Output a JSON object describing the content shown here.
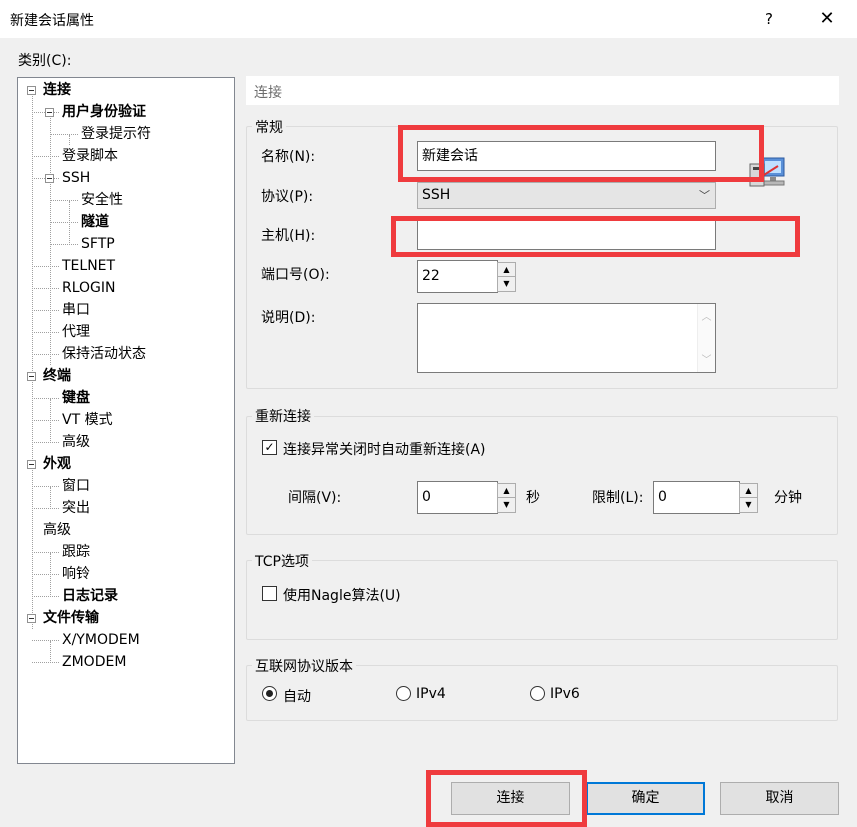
{
  "window": {
    "title": "新建会话属性",
    "help": "?",
    "close": "✕"
  },
  "category_label": "类别(C):",
  "tree": [
    {
      "label": "连接",
      "bold": true
    },
    {
      "label": "用户身份验证",
      "bold": true
    },
    {
      "label": "登录提示符",
      "bold": false
    },
    {
      "label": "登录脚本",
      "bold": false
    },
    {
      "label": "SSH",
      "bold": false
    },
    {
      "label": "安全性",
      "bold": false
    },
    {
      "label": "隧道",
      "bold": true
    },
    {
      "label": "SFTP",
      "bold": false
    },
    {
      "label": "TELNET",
      "bold": false
    },
    {
      "label": "RLOGIN",
      "bold": false
    },
    {
      "label": "串口",
      "bold": false
    },
    {
      "label": "代理",
      "bold": false
    },
    {
      "label": "保持活动状态",
      "bold": false
    },
    {
      "label": "终端",
      "bold": true
    },
    {
      "label": "键盘",
      "bold": true
    },
    {
      "label": "VT 模式",
      "bold": false
    },
    {
      "label": "高级",
      "bold": false
    },
    {
      "label": "外观",
      "bold": true
    },
    {
      "label": "窗口",
      "bold": false
    },
    {
      "label": "突出",
      "bold": false
    },
    {
      "label": "高级",
      "bold": false
    },
    {
      "label": "跟踪",
      "bold": false
    },
    {
      "label": "响铃",
      "bold": false
    },
    {
      "label": "日志记录",
      "bold": true
    },
    {
      "label": "文件传输",
      "bold": true
    },
    {
      "label": "X/YMODEM",
      "bold": false
    },
    {
      "label": "ZMODEM",
      "bold": false
    }
  ],
  "panel_title": "连接",
  "general": {
    "group": "常规",
    "name_label": "名称(N):",
    "name_value": "新建会话",
    "protocol_label": "协议(P):",
    "protocol_value": "SSH",
    "host_label": "主机(H):",
    "host_value": "",
    "port_label": "端口号(O):",
    "port_value": "22",
    "desc_label": "说明(D):",
    "desc_value": ""
  },
  "reconnect": {
    "group": "重新连接",
    "auto_label": "连接异常关闭时自动重新连接(A)",
    "auto_checked": true,
    "interval_label": "间隔(V):",
    "interval_value": "0",
    "interval_unit": "秒",
    "limit_label": "限制(L):",
    "limit_value": "0",
    "limit_unit": "分钟"
  },
  "tcp": {
    "group": "TCP选项",
    "nagle_label": "使用Nagle算法(U)",
    "nagle_checked": false
  },
  "ipver": {
    "group": "互联网协议版本",
    "options": [
      "自动",
      "IPv4",
      "IPv6"
    ],
    "selected": "自动"
  },
  "buttons": {
    "connect": "连接",
    "ok": "确定",
    "cancel": "取消"
  },
  "colors": {
    "highlight": "#ef3b3e",
    "default_button_border": "#0078d7"
  }
}
